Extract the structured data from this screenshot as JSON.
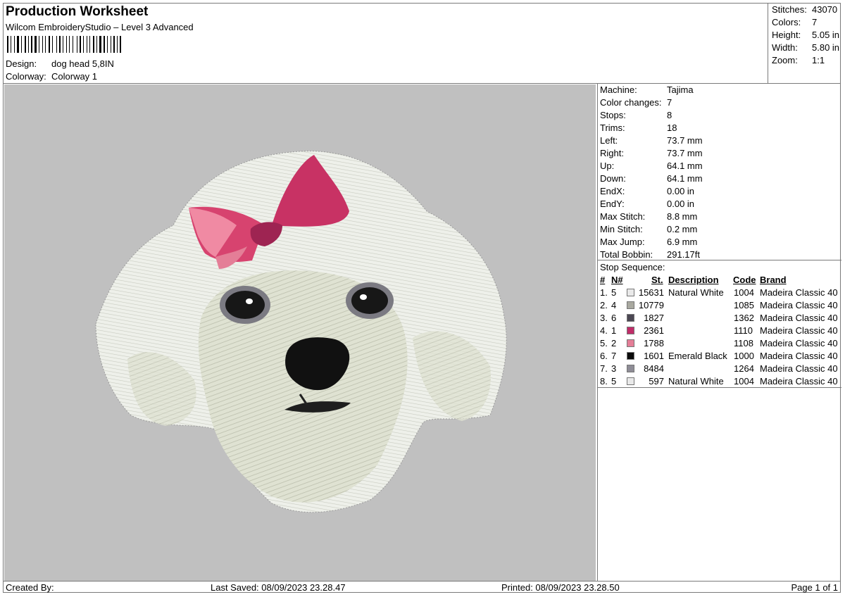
{
  "header": {
    "title": "Production Worksheet",
    "subtitle": "Wilcom EmbroideryStudio – Level 3 Advanced",
    "design_label": "Design:",
    "design_value": "dog head 5,8IN",
    "colorway_label": "Colorway:",
    "colorway_value": "Colorway 1"
  },
  "stats": [
    {
      "label": "Stitches:",
      "value": "43070"
    },
    {
      "label": "Colors:",
      "value": "7"
    },
    {
      "label": "Height:",
      "value": "5.05 in"
    },
    {
      "label": "Width:",
      "value": "5.80 in"
    },
    {
      "label": "Zoom:",
      "value": "1:1"
    }
  ],
  "machine_specs": [
    {
      "label": "Machine:",
      "value": "Tajima"
    },
    {
      "label": "Color changes:",
      "value": "7"
    },
    {
      "label": "Stops:",
      "value": "8"
    },
    {
      "label": "Trims:",
      "value": "18"
    },
    {
      "label": "Left:",
      "value": "73.7 mm"
    },
    {
      "label": "Right:",
      "value": "73.7 mm"
    },
    {
      "label": "Up:",
      "value": "64.1 mm"
    },
    {
      "label": "Down:",
      "value": "64.1 mm"
    },
    {
      "label": "EndX:",
      "value": "0.00 in"
    },
    {
      "label": "EndY:",
      "value": "0.00 in"
    },
    {
      "label": "Max Stitch:",
      "value": "8.8 mm"
    },
    {
      "label": "Min Stitch:",
      "value": "0.2 mm"
    },
    {
      "label": "Max Jump:",
      "value": "6.9 mm"
    },
    {
      "label": "Total Bobbin:",
      "value": "291.17ft"
    }
  ],
  "stop_sequence": {
    "title": "Stop Sequence:",
    "headers": {
      "num": "#",
      "n": "N#",
      "st": "St.",
      "description": "Description",
      "code": "Code",
      "brand": "Brand"
    },
    "rows": [
      {
        "num": "1.",
        "n": "5",
        "color": "#e9e9e9",
        "st": "15631",
        "description": "Natural White",
        "code": "1004",
        "brand": "Madeira Classic 40"
      },
      {
        "num": "2.",
        "n": "4",
        "color": "#a9a9a0",
        "st": "10779",
        "description": "",
        "code": "1085",
        "brand": "Madeira Classic 40"
      },
      {
        "num": "3.",
        "n": "6",
        "color": "#4b4753",
        "st": "1827",
        "description": "",
        "code": "1362",
        "brand": "Madeira Classic 40"
      },
      {
        "num": "4.",
        "n": "1",
        "color": "#c02d69",
        "st": "2361",
        "description": "",
        "code": "1110",
        "brand": "Madeira Classic 40"
      },
      {
        "num": "5.",
        "n": "2",
        "color": "#e47e97",
        "st": "1788",
        "description": "",
        "code": "1108",
        "brand": "Madeira Classic 40"
      },
      {
        "num": "6.",
        "n": "7",
        "color": "#0a0a0a",
        "st": "1601",
        "description": "Emerald Black",
        "code": "1000",
        "brand": "Madeira Classic 40"
      },
      {
        "num": "7.",
        "n": "3",
        "color": "#8e8c96",
        "st": "8484",
        "description": "",
        "code": "1264",
        "brand": "Madeira Classic 40"
      },
      {
        "num": "8.",
        "n": "5",
        "color": "#e9e9e9",
        "st": "597",
        "description": "Natural White",
        "code": "1004",
        "brand": "Madeira Classic 40"
      }
    ]
  },
  "footer": {
    "created_by": "Created By:",
    "last_saved": "Last Saved: 08/09/2023 23.28.47",
    "printed": "Printed: 08/09/2023 23.28.50",
    "page": "Page 1 of 1"
  },
  "colors": {
    "canvas_background": "#c0c0c0",
    "border": "#7a7a7a"
  }
}
